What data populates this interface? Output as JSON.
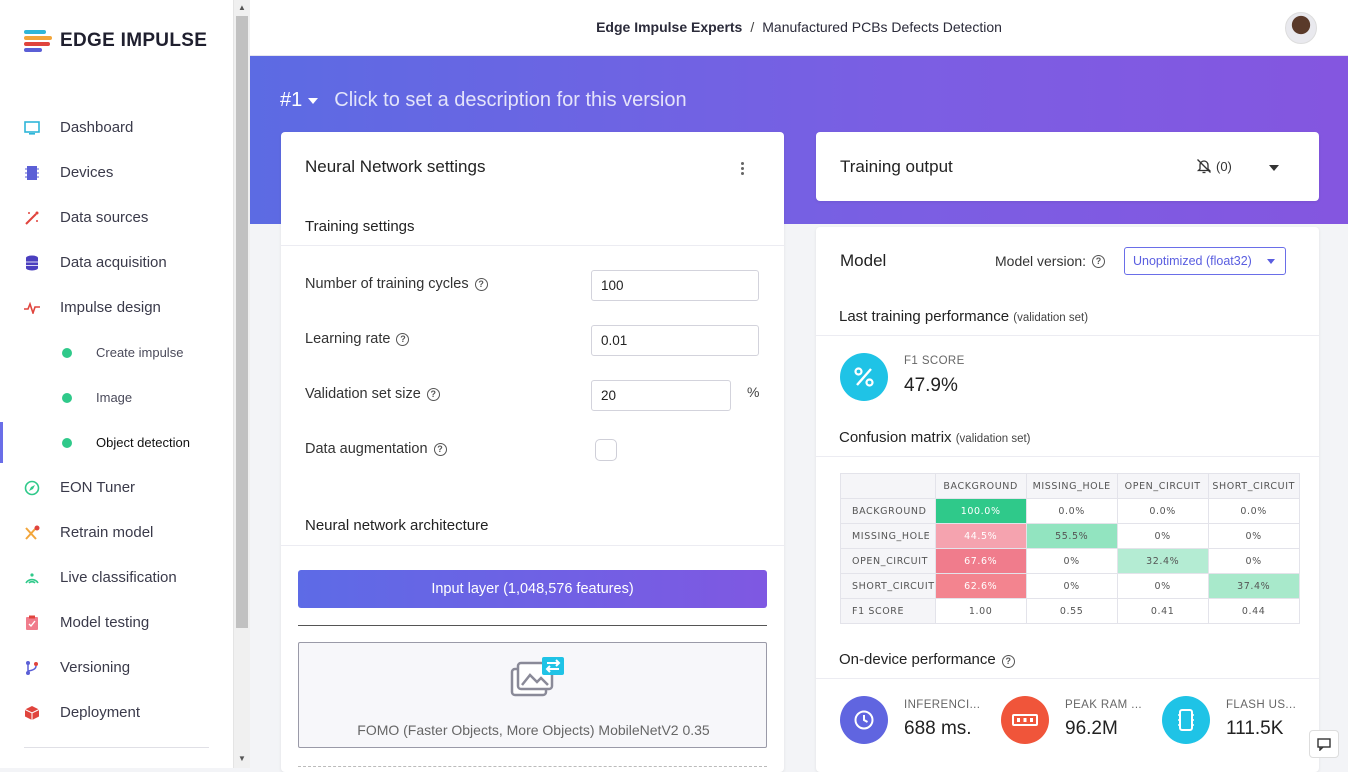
{
  "brand": {
    "name": "EDGE IMPULSE",
    "colors": [
      "#2fb6d8",
      "#f2a53a",
      "#e0443d",
      "#5b5fd6"
    ]
  },
  "breadcrumb": {
    "org": "Edge Impulse Experts",
    "separator": "/",
    "project": "Manufactured PCBs Defects Detection"
  },
  "sidebar": {
    "items": [
      {
        "label": "Dashboard",
        "icon": "monitor-icon"
      },
      {
        "label": "Devices",
        "icon": "chip-icon"
      },
      {
        "label": "Data sources",
        "icon": "wand-icon"
      },
      {
        "label": "Data acquisition",
        "icon": "database-icon"
      },
      {
        "label": "Impulse design",
        "icon": "pulse-icon"
      },
      {
        "label": "Create impulse",
        "sub": true
      },
      {
        "label": "Image",
        "sub": true
      },
      {
        "label": "Object detection",
        "sub": true,
        "active": true
      },
      {
        "label": "EON Tuner",
        "icon": "compass-icon"
      },
      {
        "label": "Retrain model",
        "icon": "retrain-icon"
      },
      {
        "label": "Live classification",
        "icon": "live-icon"
      },
      {
        "label": "Model testing",
        "icon": "clipboard-icon"
      },
      {
        "label": "Versioning",
        "icon": "branch-icon"
      },
      {
        "label": "Deployment",
        "icon": "box-icon"
      }
    ]
  },
  "version": {
    "number": "#1",
    "description": "Click to set a description for this version"
  },
  "nn": {
    "title": "Neural Network settings",
    "training_title": "Training settings",
    "cycles_label": "Number of training cycles",
    "cycles_value": "100",
    "lr_label": "Learning rate",
    "lr_value": "0.01",
    "val_label": "Validation set size",
    "val_value": "20",
    "val_unit": "%",
    "aug_label": "Data augmentation",
    "aug_checked": false,
    "arch_title": "Neural network architecture",
    "input_layer": "Input layer (1,048,576 features)",
    "block_label": "FOMO (Faster Objects, More Objects) MobileNetV2 0.35"
  },
  "output": {
    "title": "Training output",
    "notif_count": "(0)"
  },
  "model": {
    "title": "Model",
    "version_label": "Model version:",
    "version_value": "Unoptimized (float32)",
    "last_perf": "Last training performance",
    "last_perf_note": "(validation set)",
    "f1_label": "F1 SCORE",
    "f1_value": "47.9%",
    "cm_title": "Confusion matrix",
    "cm_note": "(validation set)",
    "cm_columns": [
      "BACKGROUND",
      "MISSING_HOLE",
      "OPEN_CIRCUIT",
      "SHORT_CIRCUIT"
    ],
    "cm_rows": [
      {
        "label": "BACKGROUND",
        "cells": [
          "100.0%",
          "0.0%",
          "0.0%",
          "0.0%"
        ]
      },
      {
        "label": "MISSING_HOLE",
        "cells": [
          "44.5%",
          "55.5%",
          "0%",
          "0%"
        ]
      },
      {
        "label": "OPEN_CIRCUIT",
        "cells": [
          "67.6%",
          "0%",
          "32.4%",
          "0%"
        ]
      },
      {
        "label": "SHORT_CIRCUIT",
        "cells": [
          "62.6%",
          "0%",
          "0%",
          "37.4%"
        ]
      },
      {
        "label": "F1 SCORE",
        "cells": [
          "1.00",
          "0.55",
          "0.41",
          "0.44"
        ]
      }
    ],
    "ondevice_title": "On-device performance",
    "inference_label": "INFERENCI...",
    "inference_value": "688 ms.",
    "ram_label": "PEAK RAM ...",
    "ram_value": "96.2M",
    "flash_label": "FLASH US...",
    "flash_value": "111.5K"
  },
  "colors": {
    "accent": "#6a6ee8",
    "good": "#2fc98a",
    "bad": "#f07c8c",
    "cyan": "#1fc3e6",
    "orange": "#f0553a",
    "violet": "#6065e0"
  }
}
